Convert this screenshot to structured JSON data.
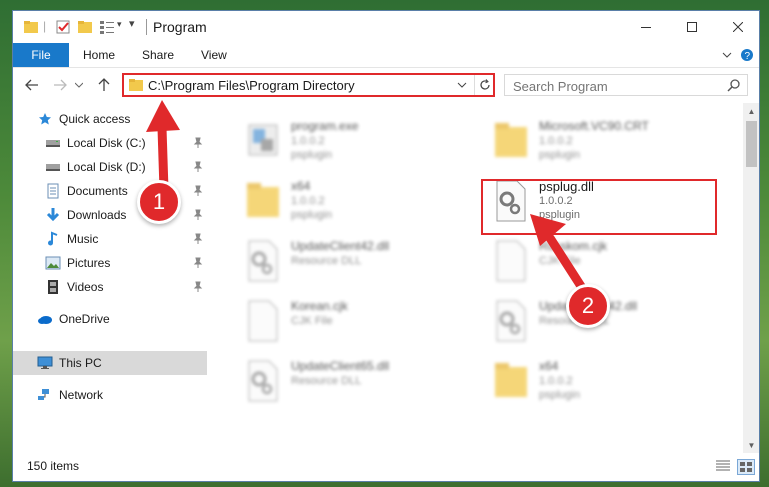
{
  "window": {
    "title": "Program",
    "accent": "#1979ca",
    "annotation_color": "#e0292b"
  },
  "ribbon": {
    "file_label": "File",
    "tabs": [
      "Home",
      "Share",
      "View"
    ]
  },
  "address": {
    "path": "C:\\Program Files\\Program Directory"
  },
  "search": {
    "placeholder": "Search Program"
  },
  "nav": {
    "quick_access": "Quick access",
    "items": [
      {
        "label": "Local Disk (C:)",
        "icon": "drive-icon"
      },
      {
        "label": "Local Disk (D:)",
        "icon": "drive-icon"
      },
      {
        "label": "Documents",
        "icon": "documents-icon"
      },
      {
        "label": "Downloads",
        "icon": "downloads-icon"
      },
      {
        "label": "Music",
        "icon": "music-icon"
      },
      {
        "label": "Pictures",
        "icon": "pictures-icon"
      },
      {
        "label": "Videos",
        "icon": "videos-icon"
      }
    ],
    "onedrive": "OneDrive",
    "this_pc": "This PC",
    "network": "Network"
  },
  "files": {
    "program_exe": {
      "name": "program.exe",
      "line2": "1.0.0.2",
      "line3": "psplugin"
    },
    "vc90": {
      "name": "Microsoft.VC90.CRT",
      "line2": "1.0.0.2",
      "line3": "psplugin"
    },
    "x64": {
      "name": "x64",
      "line2": "1.0.0.2",
      "line3": "psplugin"
    },
    "psplug": {
      "name": "psplug.dll",
      "line2": "1.0.0.2",
      "line3": "psplugin"
    },
    "update42_left": {
      "name": "UpdateClient42.dll",
      "line2": "Resource DLL"
    },
    "korean_right": {
      "name": "Russkom.cjk",
      "line2": "CJK File"
    },
    "korean_left": {
      "name": "Korean.cjk",
      "line2": "CJK File"
    },
    "update42_right": {
      "name": "UpdateClient42.dll",
      "line2": "Resource DLL"
    },
    "update65": {
      "name": "UpdateClient65.dll",
      "line2": "Resource DLL"
    },
    "x64_right": {
      "name": "x64",
      "line2": "1.0.0.2",
      "line3": "psplugin"
    }
  },
  "status": {
    "items_count": "150 items"
  },
  "annotations": {
    "step1": "1",
    "step2": "2"
  }
}
